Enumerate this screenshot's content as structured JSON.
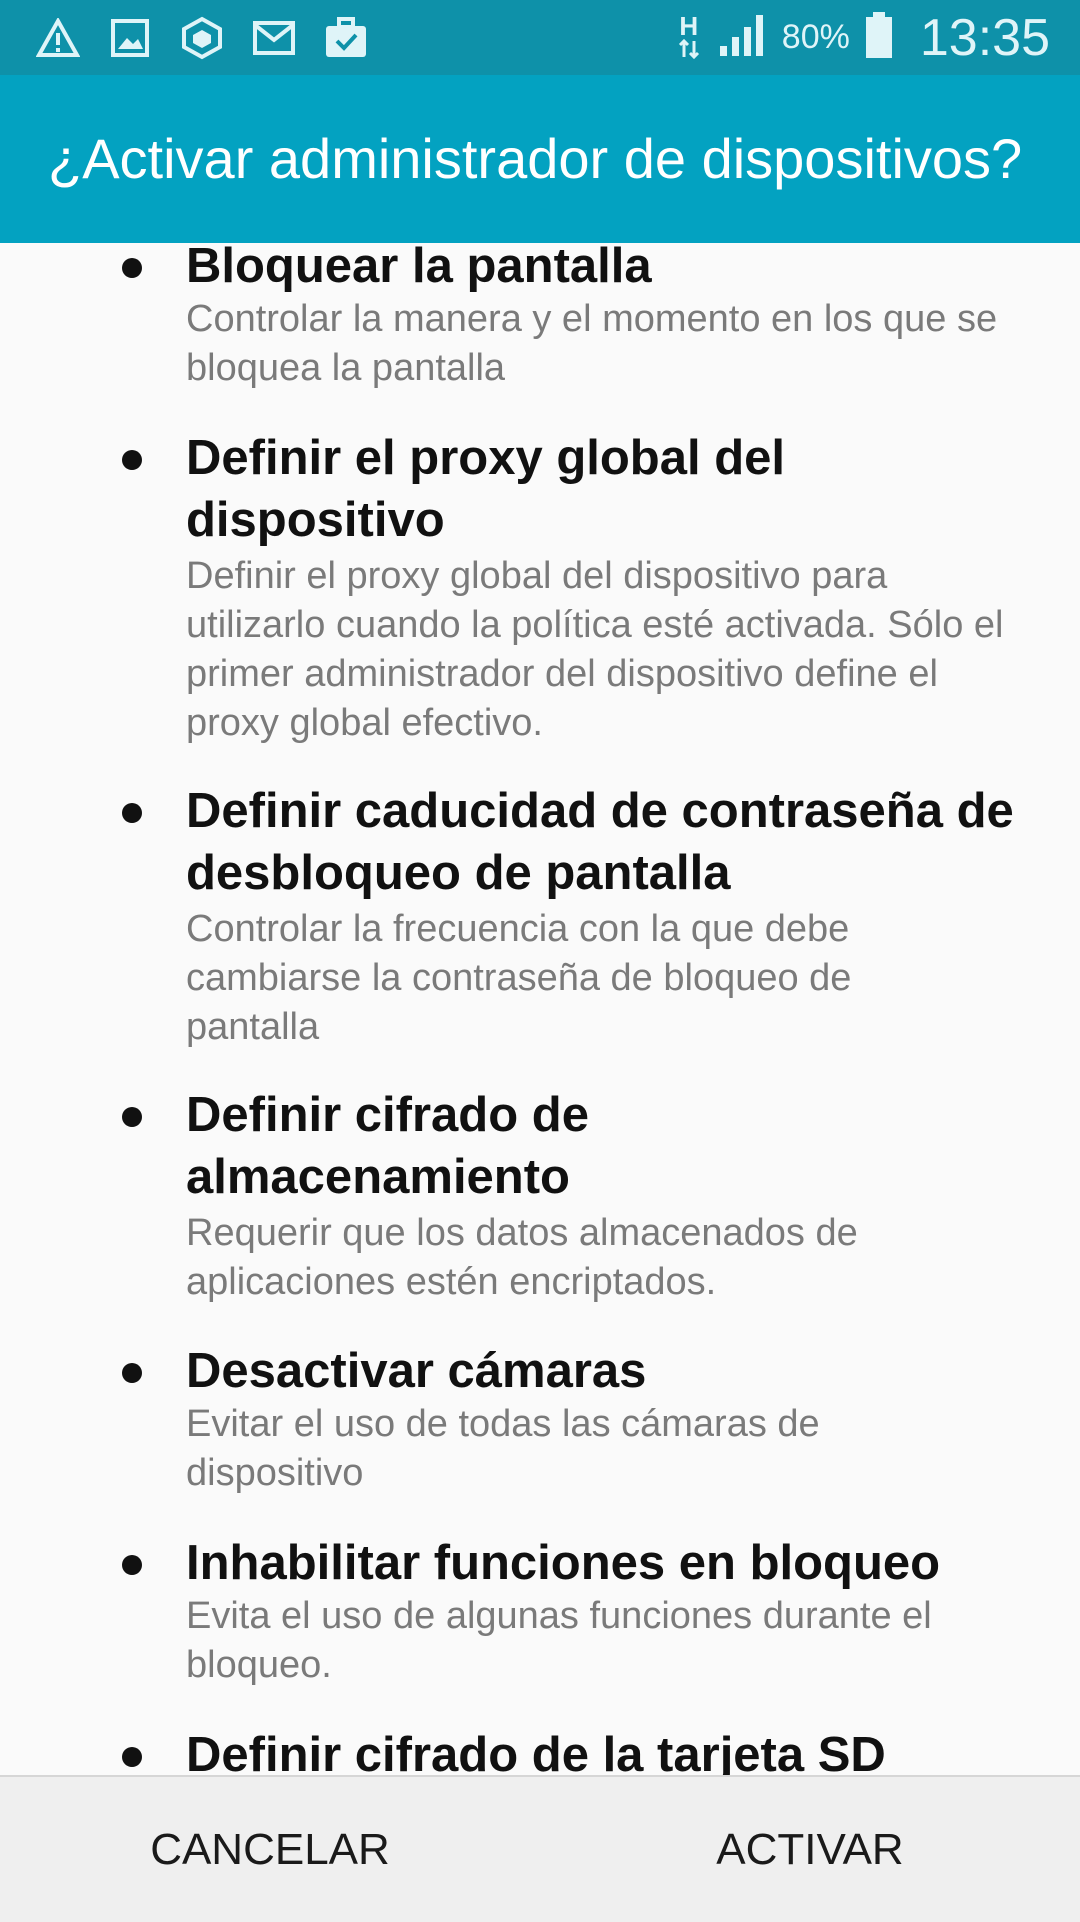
{
  "status_bar": {
    "icons_left": [
      "warning-icon",
      "gallery-icon",
      "box-icon",
      "email-icon",
      "briefcase-icon"
    ],
    "network_type": "H",
    "battery_percent": "80%",
    "time": "13:35"
  },
  "dialog": {
    "title": "¿Activar administrador de dispositivos?"
  },
  "policies": [
    {
      "title": "Bloquear la pantalla",
      "description": "Controlar la manera y el momento en los que se bloquea la pantalla"
    },
    {
      "title": "Definir el proxy global del dispositivo",
      "description": "Definir el proxy global del dispositivo para utilizarlo cuando la política esté activada. Sólo el primer administrador del dispositivo define el proxy global efectivo."
    },
    {
      "title": "Definir caducidad de contraseña de desbloqueo de pantalla",
      "description": "Controlar la frecuencia con la que debe cambiarse la contraseña de bloqueo de pantalla"
    },
    {
      "title": "Definir cifrado de almacenamiento",
      "description": "Requerir que los datos almacenados de aplicaciones estén encriptados."
    },
    {
      "title": "Desactivar cámaras",
      "description": "Evitar el uso de todas las cámaras de dispositivo"
    },
    {
      "title": "Inhabilitar funciones en bloqueo",
      "description": "Evita el uso de algunas funciones durante el bloqueo."
    },
    {
      "title": "Definir cifrado de la tarjeta SD",
      "description": ""
    }
  ],
  "footer": {
    "cancel_label": "CANCELAR",
    "activate_label": "ACTIVAR"
  },
  "colors": {
    "status_bar": "#0e91a9",
    "title_bar": "#03a2c1"
  }
}
